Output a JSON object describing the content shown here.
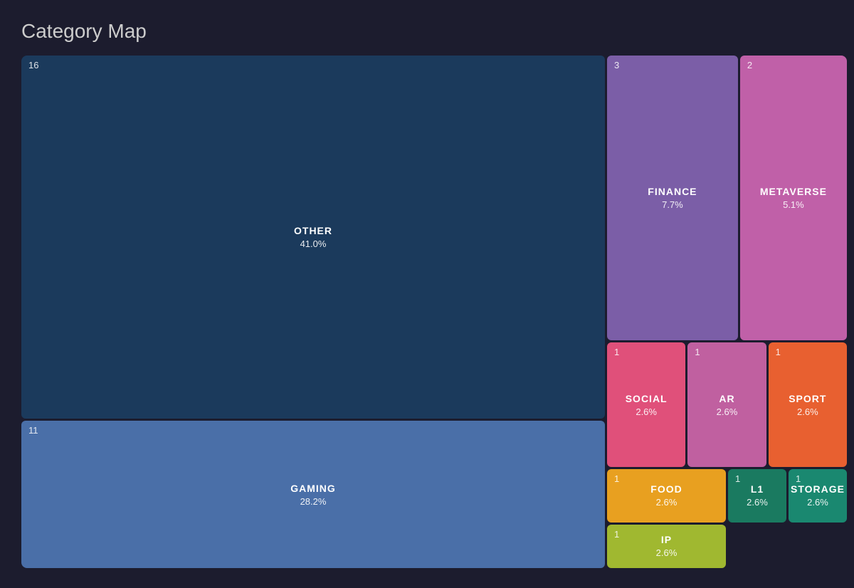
{
  "title": "Category Map",
  "cells": {
    "other": {
      "label": "OTHER",
      "value": "41.0%",
      "count": "16"
    },
    "gaming": {
      "label": "GAMING",
      "value": "28.2%",
      "count": "11"
    },
    "finance": {
      "label": "FINANCE",
      "value": "7.7%",
      "count": "3"
    },
    "metaverse": {
      "label": "METAVERSE",
      "value": "5.1%",
      "count": "2"
    },
    "social": {
      "label": "SOCIAL",
      "value": "2.6%",
      "count": "1"
    },
    "ar": {
      "label": "AR",
      "value": "2.6%",
      "count": "1"
    },
    "sport": {
      "label": "SPORT",
      "value": "2.6%",
      "count": "1"
    },
    "food": {
      "label": "FOOD",
      "value": "2.6%",
      "count": "1"
    },
    "ip": {
      "label": "IP",
      "value": "2.6%",
      "count": "1"
    },
    "l1": {
      "label": "L1",
      "value": "2.6%",
      "count": "1"
    },
    "storage": {
      "label": "STORAGE",
      "value": "2.6%",
      "count": "1"
    }
  }
}
